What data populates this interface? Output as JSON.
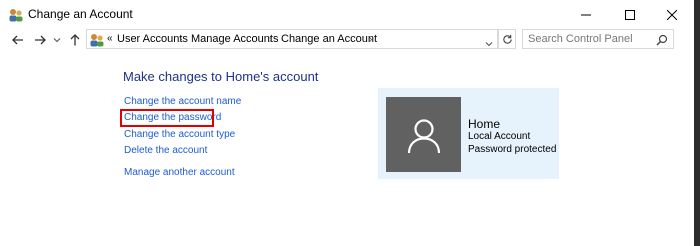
{
  "window": {
    "title": "Change an Account"
  },
  "nav": {
    "breadcrumbs": [
      "User Accounts",
      "Manage Accounts",
      "Change an Account"
    ],
    "overflow_marker": "«",
    "search_placeholder": "Search Control Panel"
  },
  "main": {
    "heading": "Make changes to Home's account",
    "links": [
      "Change the account name",
      "Change the password",
      "Change the account type",
      "Delete the account",
      "Manage another account"
    ],
    "highlighted_link_index": 1
  },
  "account": {
    "name": "Home",
    "type": "Local Account",
    "status": "Password protected"
  },
  "colors": {
    "link": "#1e5bd6",
    "heading": "#1e3287",
    "highlight": "#e00000",
    "card_bg": "#e6f2fc",
    "avatar_bg": "#616161"
  }
}
